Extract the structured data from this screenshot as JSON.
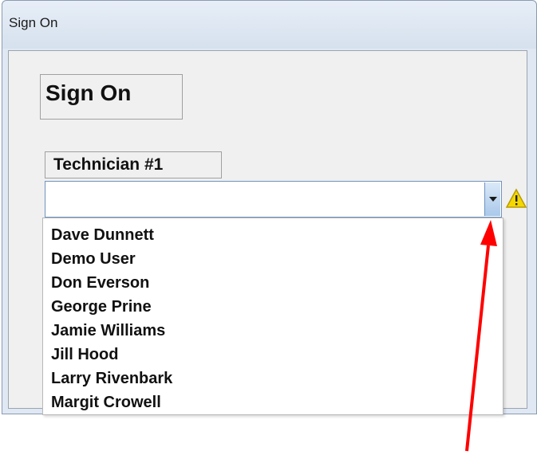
{
  "window": {
    "title": "Sign On"
  },
  "form": {
    "heading": "Sign On",
    "technician_label": "Technician #1",
    "technician_value": ""
  },
  "dropdown": {
    "items": [
      "Dave Dunnett",
      "Demo User",
      "Don Everson",
      "George Prine",
      "Jamie Williams",
      "Jill Hood",
      "Larry Rivenbark",
      "Margit Crowell"
    ]
  },
  "icons": {
    "dropdown_arrow": "chevron-down-icon",
    "warning": "warning-icon",
    "annotation": "red-arrow-annotation"
  },
  "colors": {
    "annotation_arrow": "#ff0000",
    "warning_fill": "#f5d800"
  }
}
